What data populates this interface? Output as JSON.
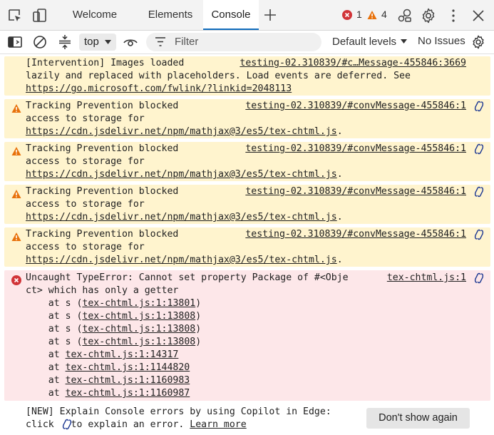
{
  "tabs": {
    "items": [
      "Welcome",
      "Elements",
      "Console"
    ],
    "error_count": "1",
    "warning_count": "4"
  },
  "toolbar": {
    "context": "top",
    "filter_placeholder": "Filter",
    "levels": "Default levels",
    "issues": "No Issues"
  },
  "messages": [
    {
      "level": "info",
      "lines": [
        "[Intervention] Images loaded",
        "lazily and replaced with placeholders. Load events are deferred. See"
      ],
      "link": "https://go.microsoft.com/fwlink/?linkid=2048113",
      "source": "testing-02.310839/#c…Message-455846:3669"
    },
    {
      "level": "warning",
      "lines": [
        "Tracking Prevention blocked",
        "access to storage for"
      ],
      "link": "https://cdn.jsdelivr.net/npm/mathjax@3/es5/tex-chtml.js",
      "link_suffix": ".",
      "source": "testing-02.310839/#convMessage-455846:1"
    },
    {
      "level": "warning",
      "lines": [
        "Tracking Prevention blocked",
        "access to storage for"
      ],
      "link": "https://cdn.jsdelivr.net/npm/mathjax@3/es5/tex-chtml.js",
      "link_suffix": ".",
      "source": "testing-02.310839/#convMessage-455846:1"
    },
    {
      "level": "warning",
      "lines": [
        "Tracking Prevention blocked",
        "access to storage for"
      ],
      "link": "https://cdn.jsdelivr.net/npm/mathjax@3/es5/tex-chtml.js",
      "link_suffix": ".",
      "source": "testing-02.310839/#convMessage-455846:1"
    },
    {
      "level": "warning",
      "lines": [
        "Tracking Prevention blocked",
        "access to storage for"
      ],
      "link": "https://cdn.jsdelivr.net/npm/mathjax@3/es5/tex-chtml.js",
      "link_suffix": ".",
      "source": "testing-02.310839/#convMessage-455846:1"
    }
  ],
  "error": {
    "line1": "Uncaught TypeError: Cannot set property Package of #<Obje",
    "line2": "ct> which has only a getter",
    "source": "tex-chtml.js:1",
    "stack": [
      {
        "prefix": "    at s (",
        "link": "tex-chtml.js:1:13801",
        "suffix": ")"
      },
      {
        "prefix": "    at s (",
        "link": "tex-chtml.js:1:13808",
        "suffix": ")"
      },
      {
        "prefix": "    at s (",
        "link": "tex-chtml.js:1:13808",
        "suffix": ")"
      },
      {
        "prefix": "    at s (",
        "link": "tex-chtml.js:1:13808",
        "suffix": ")"
      },
      {
        "prefix": "    at ",
        "link": "tex-chtml.js:1:14317",
        "suffix": ""
      },
      {
        "prefix": "    at ",
        "link": "tex-chtml.js:1:1144820",
        "suffix": ""
      },
      {
        "prefix": "    at ",
        "link": "tex-chtml.js:1:1160983",
        "suffix": ""
      },
      {
        "prefix": "    at ",
        "link": "tex-chtml.js:1:1160987",
        "suffix": ""
      }
    ]
  },
  "tip": {
    "line1": "[NEW] Explain Console errors by using Copilot in Edge:",
    "line2_before": "click",
    "line2_after": "to explain an error.",
    "link": "Learn more",
    "dismiss": "Don't show again"
  }
}
